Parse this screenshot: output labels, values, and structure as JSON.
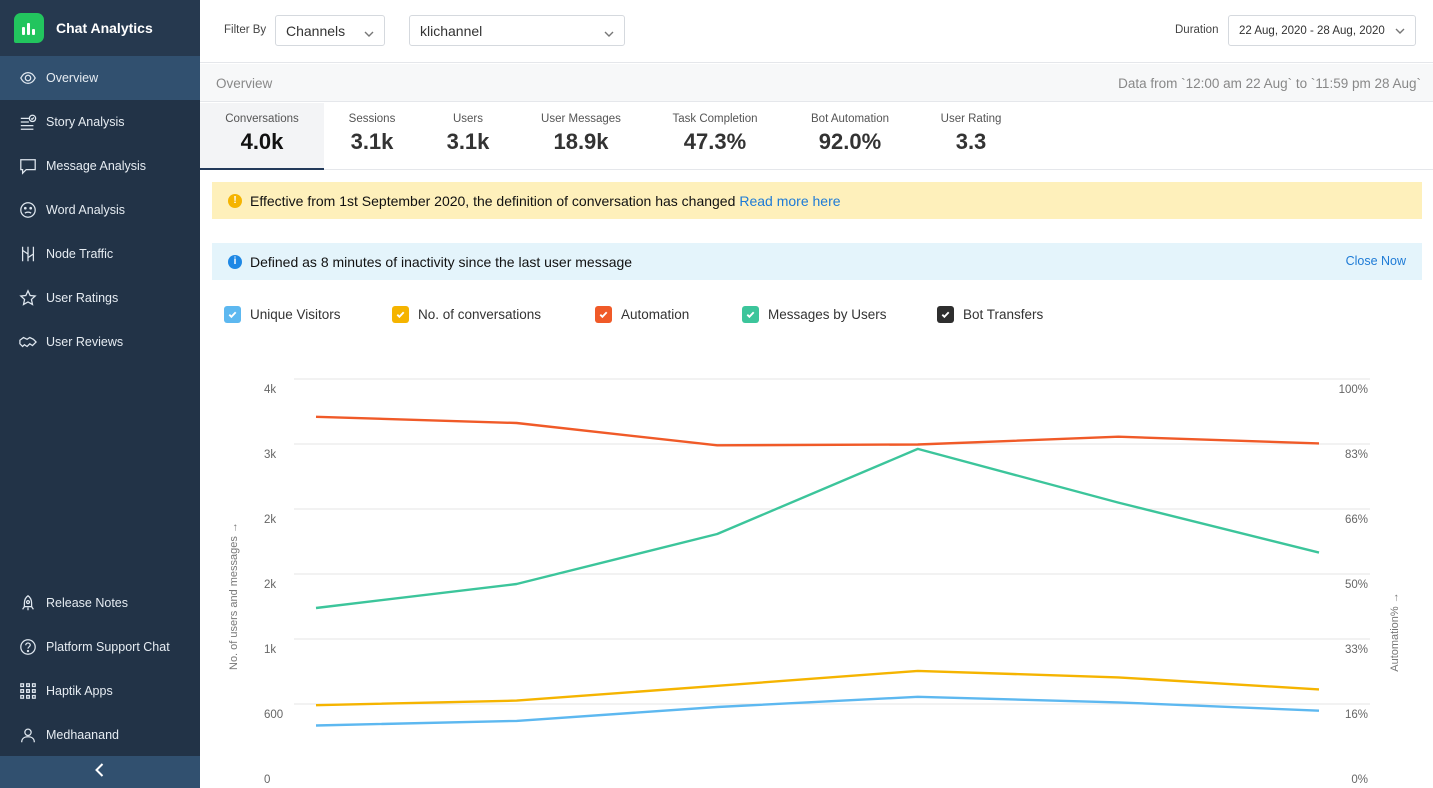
{
  "app": {
    "title": "Chat Analytics"
  },
  "sidebar": {
    "items": [
      {
        "label": "Overview",
        "icon": "eye-icon",
        "active": true
      },
      {
        "label": "Story Analysis",
        "icon": "story-list-icon"
      },
      {
        "label": "Message Analysis",
        "icon": "message-icon"
      },
      {
        "label": "Word Analysis",
        "icon": "face-icon"
      },
      {
        "label": "Node Traffic",
        "icon": "node-traffic-icon"
      },
      {
        "label": "User Ratings",
        "icon": "star-icon"
      },
      {
        "label": "User Reviews",
        "icon": "handshake-icon"
      }
    ],
    "bottom_items": [
      {
        "label": "Release Notes",
        "icon": "rocket-icon"
      },
      {
        "label": "Platform Support Chat",
        "icon": "help-circle-icon"
      },
      {
        "label": "Haptik Apps",
        "icon": "grid-icon"
      },
      {
        "label": "Medhaanand",
        "icon": "user-icon"
      }
    ],
    "collapse_icon": "chevron-left-icon"
  },
  "topbar": {
    "filter_label": "Filter By",
    "filter_type": "Channels",
    "filter_value": "klichannel",
    "duration_label": "Duration",
    "duration_value": "22 Aug, 2020 - 28 Aug, 2020"
  },
  "overview": {
    "title": "Overview",
    "data_range": "Data from `12:00 am 22 Aug` to `11:59 pm 28 Aug`"
  },
  "metrics": [
    {
      "label": "Conversations",
      "value": "4.0k",
      "active": true
    },
    {
      "label": "Sessions",
      "value": "3.1k"
    },
    {
      "label": "Users",
      "value": "3.1k"
    },
    {
      "label": "User Messages",
      "value": "18.9k"
    },
    {
      "label": "Task Completion",
      "value": "47.3%"
    },
    {
      "label": "Bot Automation",
      "value": "92.0%"
    },
    {
      "label": "User Rating",
      "value": "3.3"
    }
  ],
  "banners": {
    "warning_text": "Effective from 1st September 2020, the definition of conversation has changed",
    "warning_link": "Read more here",
    "info_text": "Defined as 8 minutes of inactivity since the last user message",
    "info_close": "Close Now"
  },
  "colors": {
    "unique_visitors": "#5db8f0",
    "conversations": "#f5b400",
    "automation": "#f05a28",
    "messages": "#3cc59b",
    "bot_transfers": "#2e2e2e"
  },
  "chart_data": {
    "type": "line",
    "ylabel_left": "No. of users and messages →",
    "ylabel_right": "Automation% →",
    "left_ticks": [
      "0",
      "600",
      "1k",
      "2k",
      "2k",
      "3k",
      "4k"
    ],
    "right_ticks": [
      "0%",
      "16%",
      "33%",
      "50%",
      "66%",
      "83%",
      "100%"
    ],
    "left_range": [
      0,
      4000
    ],
    "right_range": [
      0,
      100
    ],
    "grid": true,
    "legend_position": "top-left",
    "series": [
      {
        "name": "Unique Visitors",
        "axis": "left",
        "values": [
          470,
          520,
          670,
          780,
          720,
          630
        ],
        "checked": true
      },
      {
        "name": "No. of conversations",
        "axis": "left",
        "values": [
          690,
          740,
          900,
          1060,
          990,
          860
        ],
        "checked": true
      },
      {
        "name": "Automation",
        "axis": "right",
        "values": [
          95.2,
          93.5,
          87.5,
          87.7,
          89.8,
          88.0
        ],
        "checked": true
      },
      {
        "name": "Messages by Users",
        "axis": "left",
        "values": [
          1740,
          2000,
          2540,
          3460,
          2880,
          2340
        ],
        "checked": true
      },
      {
        "name": "Bot Transfers",
        "axis": "left",
        "values": [],
        "checked": true
      }
    ]
  }
}
